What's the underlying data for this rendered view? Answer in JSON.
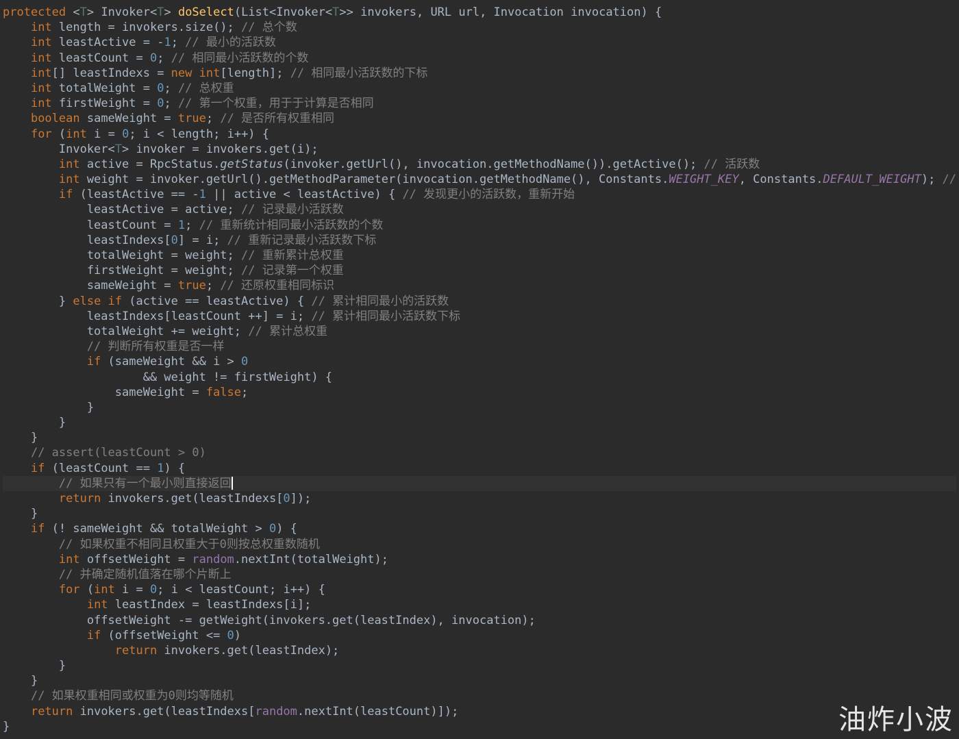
{
  "editor": {
    "language": "java",
    "colors": {
      "background": "#2b2b2b",
      "current_line": "#323232",
      "plain": "#a9b7c6",
      "keyword": "#cc7832",
      "method_decl": "#ffc66d",
      "number": "#6897bb",
      "comment": "#808080",
      "type_param": "#507874",
      "static_field": "#9876aa"
    },
    "caret_line": 31,
    "lines": [
      [
        [
          "kw",
          "protected"
        ],
        [
          "pl",
          " <"
        ],
        [
          "tp",
          "T"
        ],
        [
          "pl",
          "> Invoker<"
        ],
        [
          "tp",
          "T"
        ],
        [
          "pl",
          "> "
        ],
        [
          "fn",
          "doSelect"
        ],
        [
          "pl",
          "(List<Invoker<"
        ],
        [
          "tp",
          "T"
        ],
        [
          "pl",
          ">> invokers, URL url, Invocation invocation) {"
        ]
      ],
      [
        [
          "pl",
          "    "
        ],
        [
          "kw",
          "int"
        ],
        [
          "pl",
          " length = invokers.size(); "
        ],
        [
          "cm",
          "// 总个数"
        ]
      ],
      [
        [
          "pl",
          "    "
        ],
        [
          "kw",
          "int"
        ],
        [
          "pl",
          " leastActive = -"
        ],
        [
          "num",
          "1"
        ],
        [
          "pl",
          "; "
        ],
        [
          "cm",
          "// 最小的活跃数"
        ]
      ],
      [
        [
          "pl",
          "    "
        ],
        [
          "kw",
          "int"
        ],
        [
          "pl",
          " leastCount = "
        ],
        [
          "num",
          "0"
        ],
        [
          "pl",
          "; "
        ],
        [
          "cm",
          "// 相同最小活跃数的个数"
        ]
      ],
      [
        [
          "pl",
          "    "
        ],
        [
          "kw",
          "int"
        ],
        [
          "pl",
          "[] leastIndexs = "
        ],
        [
          "kw",
          "new"
        ],
        [
          "pl",
          " "
        ],
        [
          "kw",
          "int"
        ],
        [
          "pl",
          "[length]; "
        ],
        [
          "cm",
          "// 相同最小活跃数的下标"
        ]
      ],
      [
        [
          "pl",
          "    "
        ],
        [
          "kw",
          "int"
        ],
        [
          "pl",
          " totalWeight = "
        ],
        [
          "num",
          "0"
        ],
        [
          "pl",
          "; "
        ],
        [
          "cm",
          "// 总权重"
        ]
      ],
      [
        [
          "pl",
          "    "
        ],
        [
          "kw",
          "int"
        ],
        [
          "pl",
          " firstWeight = "
        ],
        [
          "num",
          "0"
        ],
        [
          "pl",
          "; "
        ],
        [
          "cm",
          "// 第一个权重，用于于计算是否相同"
        ]
      ],
      [
        [
          "pl",
          "    "
        ],
        [
          "kw",
          "boolean"
        ],
        [
          "pl",
          " sameWeight = "
        ],
        [
          "kw",
          "true"
        ],
        [
          "pl",
          "; "
        ],
        [
          "cm",
          "// 是否所有权重相同"
        ]
      ],
      [
        [
          "pl",
          "    "
        ],
        [
          "kw",
          "for"
        ],
        [
          "pl",
          " ("
        ],
        [
          "kw",
          "int"
        ],
        [
          "pl",
          " i = "
        ],
        [
          "num",
          "0"
        ],
        [
          "pl",
          "; i < length; i++) {"
        ]
      ],
      [
        [
          "pl",
          "        Invoker<"
        ],
        [
          "tp",
          "T"
        ],
        [
          "pl",
          "> invoker = invokers.get(i);"
        ]
      ],
      [
        [
          "pl",
          "        "
        ],
        [
          "kw",
          "int"
        ],
        [
          "pl",
          " active = RpcStatus."
        ],
        [
          "st",
          "getStatus"
        ],
        [
          "pl",
          "(invoker.getUrl(), invocation.getMethodName()).getActive(); "
        ],
        [
          "cm",
          "// 活跃数"
        ]
      ],
      [
        [
          "pl",
          "        "
        ],
        [
          "kw",
          "int"
        ],
        [
          "pl",
          " weight = invoker.getUrl().getMethodParameter(invocation.getMethodName(), Constants."
        ],
        [
          "sf",
          "WEIGHT_KEY"
        ],
        [
          "pl",
          ", Constants."
        ],
        [
          "sf",
          "DEFAULT_WEIGHT"
        ],
        [
          "pl",
          "); "
        ],
        [
          "cm",
          "// 权重"
        ]
      ],
      [
        [
          "pl",
          "        "
        ],
        [
          "kw",
          "if"
        ],
        [
          "pl",
          " (leastActive == -"
        ],
        [
          "num",
          "1"
        ],
        [
          "pl",
          " || active < leastActive) { "
        ],
        [
          "cm",
          "// 发现更小的活跃数，重新开始"
        ]
      ],
      [
        [
          "pl",
          "            leastActive = active; "
        ],
        [
          "cm",
          "// 记录最小活跃数"
        ]
      ],
      [
        [
          "pl",
          "            leastCount = "
        ],
        [
          "num",
          "1"
        ],
        [
          "pl",
          "; "
        ],
        [
          "cm",
          "// 重新统计相同最小活跃数的个数"
        ]
      ],
      [
        [
          "pl",
          "            leastIndexs["
        ],
        [
          "num",
          "0"
        ],
        [
          "pl",
          "] = i; "
        ],
        [
          "cm",
          "// 重新记录最小活跃数下标"
        ]
      ],
      [
        [
          "pl",
          "            totalWeight = weight; "
        ],
        [
          "cm",
          "// 重新累计总权重"
        ]
      ],
      [
        [
          "pl",
          "            firstWeight = weight; "
        ],
        [
          "cm",
          "// 记录第一个权重"
        ]
      ],
      [
        [
          "pl",
          "            sameWeight = "
        ],
        [
          "kw",
          "true"
        ],
        [
          "pl",
          "; "
        ],
        [
          "cm",
          "// 还原权重相同标识"
        ]
      ],
      [
        [
          "pl",
          "        } "
        ],
        [
          "kw",
          "else if"
        ],
        [
          "pl",
          " (active == leastActive) { "
        ],
        [
          "cm",
          "// 累计相同最小的活跃数"
        ]
      ],
      [
        [
          "pl",
          "            leastIndexs[leastCount ++] = i; "
        ],
        [
          "cm",
          "// 累计相同最小活跃数下标"
        ]
      ],
      [
        [
          "pl",
          "            totalWeight += weight; "
        ],
        [
          "cm",
          "// 累计总权重"
        ]
      ],
      [
        [
          "pl",
          "            "
        ],
        [
          "cm",
          "// 判断所有权重是否一样"
        ]
      ],
      [
        [
          "pl",
          "            "
        ],
        [
          "kw",
          "if"
        ],
        [
          "pl",
          " (sameWeight && i > "
        ],
        [
          "num",
          "0"
        ]
      ],
      [
        [
          "pl",
          "                    && weight != firstWeight) {"
        ]
      ],
      [
        [
          "pl",
          "                sameWeight = "
        ],
        [
          "kw",
          "false"
        ],
        [
          "pl",
          ";"
        ]
      ],
      [
        [
          "pl",
          "            }"
        ]
      ],
      [
        [
          "pl",
          "        }"
        ]
      ],
      [
        [
          "pl",
          "    }"
        ]
      ],
      [
        [
          "pl",
          "    "
        ],
        [
          "cm",
          "// assert(leastCount > 0)"
        ]
      ],
      [
        [
          "pl",
          "    "
        ],
        [
          "kw",
          "if"
        ],
        [
          "pl",
          " (leastCount == "
        ],
        [
          "num",
          "1"
        ],
        [
          "pl",
          ") {"
        ]
      ],
      [
        [
          "pl",
          "        "
        ],
        [
          "cm",
          "// 如果只有一个最小则直接返回"
        ]
      ],
      [
        [
          "pl",
          "        "
        ],
        [
          "kw",
          "return"
        ],
        [
          "pl",
          " invokers.get(leastIndexs["
        ],
        [
          "num",
          "0"
        ],
        [
          "pl",
          "]);"
        ]
      ],
      [
        [
          "pl",
          "    }"
        ]
      ],
      [
        [
          "pl",
          "    "
        ],
        [
          "kw",
          "if"
        ],
        [
          "pl",
          " (! sameWeight && totalWeight > "
        ],
        [
          "num",
          "0"
        ],
        [
          "pl",
          ") {"
        ]
      ],
      [
        [
          "pl",
          "        "
        ],
        [
          "cm",
          "// 如果权重不相同且权重大于0则按总权重数随机"
        ]
      ],
      [
        [
          "pl",
          "        "
        ],
        [
          "kw",
          "int"
        ],
        [
          "pl",
          " offsetWeight = "
        ],
        [
          "fd",
          "random"
        ],
        [
          "pl",
          ".nextInt(totalWeight);"
        ]
      ],
      [
        [
          "pl",
          "        "
        ],
        [
          "cm",
          "// 并确定随机值落在哪个片断上"
        ]
      ],
      [
        [
          "pl",
          "        "
        ],
        [
          "kw",
          "for"
        ],
        [
          "pl",
          " ("
        ],
        [
          "kw",
          "int"
        ],
        [
          "pl",
          " i = "
        ],
        [
          "num",
          "0"
        ],
        [
          "pl",
          "; i < leastCount; i++) {"
        ]
      ],
      [
        [
          "pl",
          "            "
        ],
        [
          "kw",
          "int"
        ],
        [
          "pl",
          " leastIndex = leastIndexs[i];"
        ]
      ],
      [
        [
          "pl",
          "            offsetWeight -= getWeight(invokers.get(leastIndex), invocation);"
        ]
      ],
      [
        [
          "pl",
          "            "
        ],
        [
          "kw",
          "if"
        ],
        [
          "pl",
          " (offsetWeight <= "
        ],
        [
          "num",
          "0"
        ],
        [
          "pl",
          ")"
        ]
      ],
      [
        [
          "pl",
          "                "
        ],
        [
          "kw",
          "return"
        ],
        [
          "pl",
          " invokers.get(leastIndex);"
        ]
      ],
      [
        [
          "pl",
          "        }"
        ]
      ],
      [
        [
          "pl",
          "    }"
        ]
      ],
      [
        [
          "pl",
          "    "
        ],
        [
          "cm",
          "// 如果权重相同或权重为0则均等随机"
        ]
      ],
      [
        [
          "pl",
          "    "
        ],
        [
          "kw",
          "return"
        ],
        [
          "pl",
          " invokers.get(leastIndexs["
        ],
        [
          "fd",
          "random"
        ],
        [
          "pl",
          ".nextInt(leastCount)]);"
        ]
      ],
      [
        [
          "pl",
          "}"
        ]
      ]
    ]
  },
  "watermark": {
    "text": "油炸小波"
  }
}
